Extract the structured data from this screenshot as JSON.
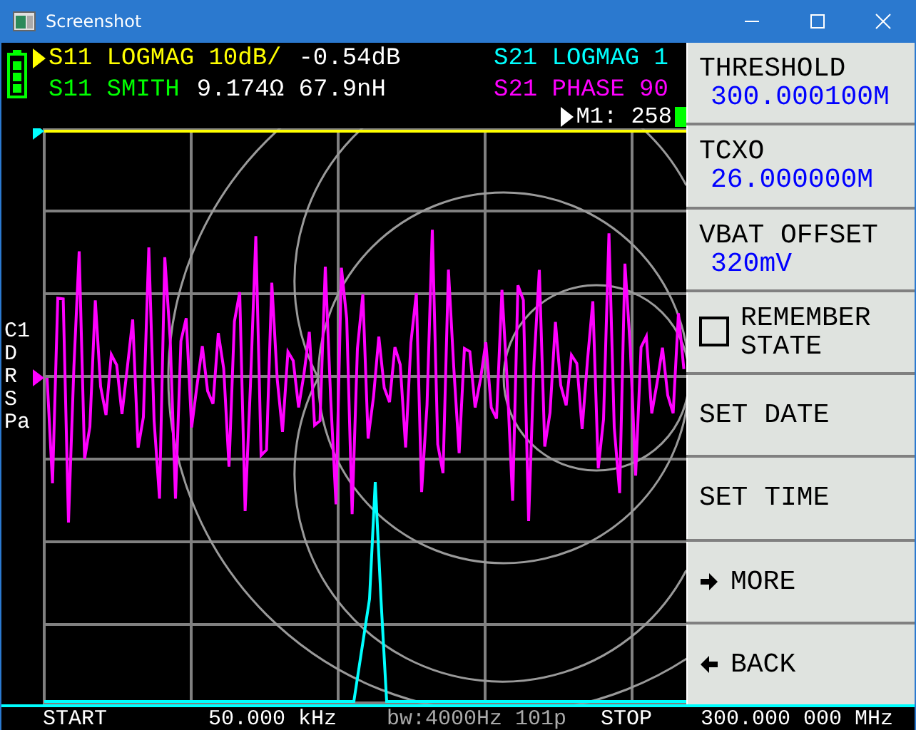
{
  "window": {
    "title": "Screenshot"
  },
  "traces": [
    {
      "label": "S11 LOGMAG 10dB/",
      "reading": "-0.54dB",
      "color": "#ffff00",
      "selected": true
    },
    {
      "label": "S21 LOGMAG 1",
      "color": "#00ffff",
      "selected": false
    },
    {
      "label": "S11 SMITH",
      "reading": "9.174Ω 67.9nH",
      "color": "#00ff00",
      "selected": false
    },
    {
      "label": "S21 PHASE 90",
      "color": "#ff00ff",
      "selected": false
    }
  ],
  "marker": {
    "label": "M1: 258"
  },
  "side_labels": [
    "C1",
    "D",
    "R",
    "S",
    "Pa"
  ],
  "menu": [
    {
      "kind": "value",
      "label": "THRESHOLD",
      "value": "300.000100M"
    },
    {
      "kind": "value",
      "label": "TCXO",
      "value": "26.000000M"
    },
    {
      "kind": "value",
      "label": "VBAT OFFSET",
      "value": "320mV"
    },
    {
      "kind": "checkbox",
      "label": "REMEMBER STATE",
      "checked": false
    },
    {
      "kind": "plain",
      "label": "SET DATE"
    },
    {
      "kind": "plain",
      "label": "SET TIME"
    },
    {
      "kind": "submenu",
      "label": "MORE"
    },
    {
      "kind": "back",
      "label": "BACK"
    }
  ],
  "footer": {
    "start_label": "START",
    "start": "50.000 kHz",
    "bandwidth": "bw:4000Hz 101p",
    "stop_label": "STOP",
    "stop": "300.000 000 MHz"
  }
}
